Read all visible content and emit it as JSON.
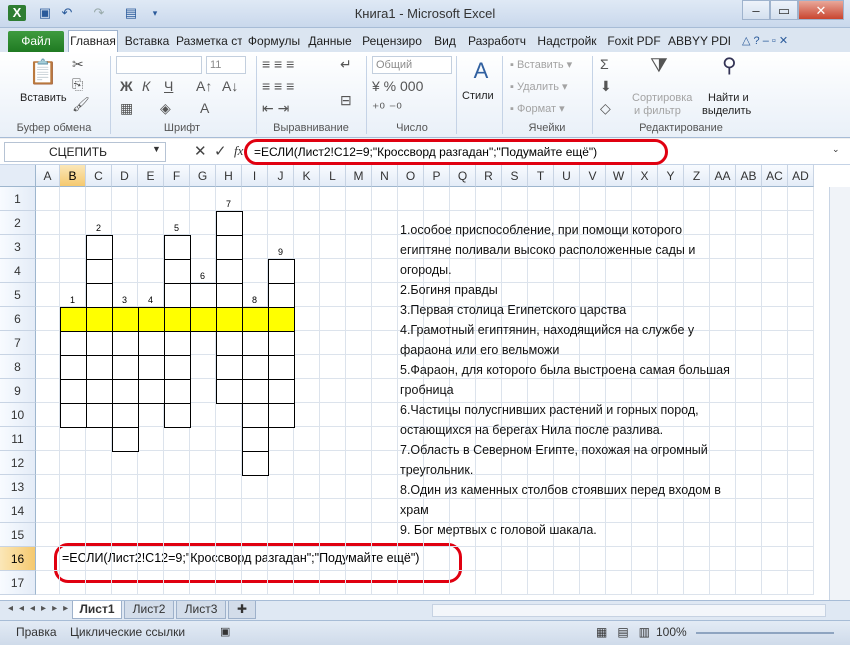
{
  "window": {
    "title": "Книга1 - Microsoft Excel"
  },
  "qat": {
    "save_icon": "save-icon",
    "undo_icon": "undo-icon",
    "redo_icon": "redo-icon"
  },
  "tabs": {
    "file": "Файл",
    "items": [
      "Главная",
      "Вставка",
      "Разметка ст",
      "Формулы",
      "Данные",
      "Рецензиро",
      "Вид",
      "Разработч",
      "Надстройк",
      "Foxit PDF",
      "ABBYY PDF"
    ]
  },
  "ribbon": {
    "clipboard": {
      "paste": "Вставить",
      "label": "Буфер обмена"
    },
    "font": {
      "size": "11",
      "bold": "Ж",
      "italic": "К",
      "underline": "Ч",
      "label": "Шрифт"
    },
    "alignment": {
      "label": "Выравнивание"
    },
    "number": {
      "format": "Общий",
      "label": "Число"
    },
    "styles": {
      "label": "Стили"
    },
    "cells": {
      "insert": "Вставить",
      "delete": "Удалить",
      "format": "Формат",
      "label": "Ячейки"
    },
    "editing": {
      "sort": "Сортировка\nи фильтр",
      "sort1": "Сортировка",
      "sort2": "и фильтр",
      "find1": "Найти и",
      "find2": "выделить",
      "label": "Редактирование"
    }
  },
  "formula_bar": {
    "name_box": "СЦЕПИТЬ",
    "fx": "fx",
    "formula": "=ЕСЛИ(Лист2!C12=9;\"Кроссворд разгадан\";\"Подумайте ещё\")"
  },
  "columns": [
    "A",
    "B",
    "C",
    "D",
    "E",
    "F",
    "G",
    "H",
    "I",
    "J",
    "K",
    "L",
    "M",
    "N",
    "O",
    "P",
    "Q",
    "R",
    "S",
    "T",
    "U",
    "V",
    "W",
    "X",
    "Y",
    "Z",
    "AA",
    "AB",
    "AC",
    "AD"
  ],
  "rows": [
    "1",
    "2",
    "3",
    "4",
    "5",
    "6",
    "7",
    "8",
    "9",
    "10",
    "11",
    "12",
    "13",
    "14",
    "15",
    "16",
    "17"
  ],
  "crossword": {
    "numbers": [
      "1",
      "2",
      "3",
      "4",
      "5",
      "6",
      "7",
      "8",
      "9"
    ]
  },
  "questions": [
    "1.особое приспособление, при помощи которого",
    "египтяне поливали высоко расположенные сады и",
    "огороды.",
    "2.Богиня правды",
    "3.Первая столица Египетского царства",
    "4.Грамотный египтянин, находящийся на службе у",
    "фараона или его вельможи",
    "5.Фараон, для которого была выстроена самая большая",
    "гробница",
    "6.Частицы полусгнивших растений и горных пород,",
    "остающихся на берегах Нила после разлива.",
    "7.Область в Северном Египте, похожая на огромный",
    "треугольник.",
    "8.Один из каменных столбов стоявших перед входом в",
    "храм",
    "9. Бог мертвых с головой шакала."
  ],
  "active_cell_text": "=ЕСЛИ(Лист2!C12=9;\"Кроссворд разгадан\";\"Подумайте ещё\")",
  "sheets": [
    "Лист1",
    "Лист2",
    "Лист3"
  ],
  "status": {
    "mode": "Правка",
    "circular": "Циклические ссылки",
    "zoom": "100%"
  },
  "colors": {
    "highlight": "#ffff00",
    "annotation": "#e00010",
    "file_tab": "#2a8a2e"
  }
}
